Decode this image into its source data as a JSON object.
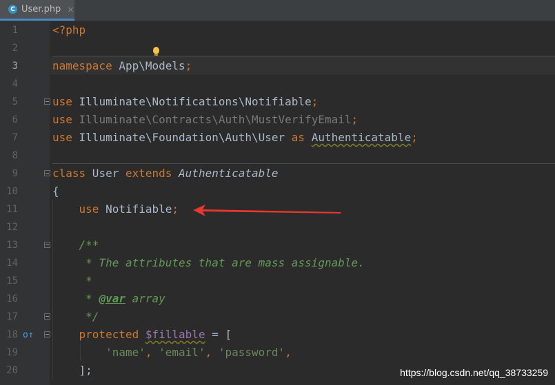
{
  "tab": {
    "icon": "C",
    "label": "User.php",
    "close": "×"
  },
  "gutter": [
    "1",
    "2",
    "3",
    "4",
    "5",
    "6",
    "7",
    "8",
    "9",
    "10",
    "11",
    "12",
    "13",
    "14",
    "15",
    "16",
    "17",
    "18",
    "19",
    "20"
  ],
  "code": {
    "l1": "<?php",
    "l3_kw": "namespace",
    "l3_rest": " App\\Models",
    "l3_semi": ";",
    "l5_kw": "use",
    "l5_rest": " Illuminate\\Notifications\\Notifiable",
    "l5_semi": ";",
    "l6_kw": "use",
    "l6_rest": " Illuminate\\Contracts\\Auth\\MustVerifyEmail",
    "l6_semi": ";",
    "l7_kw": "use",
    "l7_rest": " Illuminate\\Foundation\\Auth\\User ",
    "l7_as": "as",
    "l7_alias": "Authenticatable",
    "l7_semi": ";",
    "l9_kw": "class",
    "l9_name": " User ",
    "l9_ext": "extends",
    "l9_parent": " Authenticatable",
    "l10": "{",
    "l11_kw": "use",
    "l11_rest": " Notifiable",
    "l11_semi": ";",
    "l13": "/**",
    "l14": " * The attributes that are mass assignable.",
    "l15": " *",
    "l16_pre": " * ",
    "l16_tag": "@var",
    "l16_rest": " array",
    "l17": " */",
    "l18_kw": "protected",
    "l18_var": "$fillable",
    "l18_rest": " = [",
    "l19_s1": "'name'",
    "l19_s2": "'email'",
    "l19_s3": "'password'",
    "l19_comma": ",",
    "l20": "];"
  },
  "colors": {
    "keyword": "#cc7832",
    "comment": "#629755",
    "string": "#6a8759",
    "variable": "#9876aa",
    "text": "#a9b7c6",
    "arrow": "#e8372c"
  },
  "icons": {
    "bulb": "lightbulb-icon",
    "override": "override-gutter-icon"
  },
  "watermark": "https://blog.csdn.net/qq_38733259"
}
